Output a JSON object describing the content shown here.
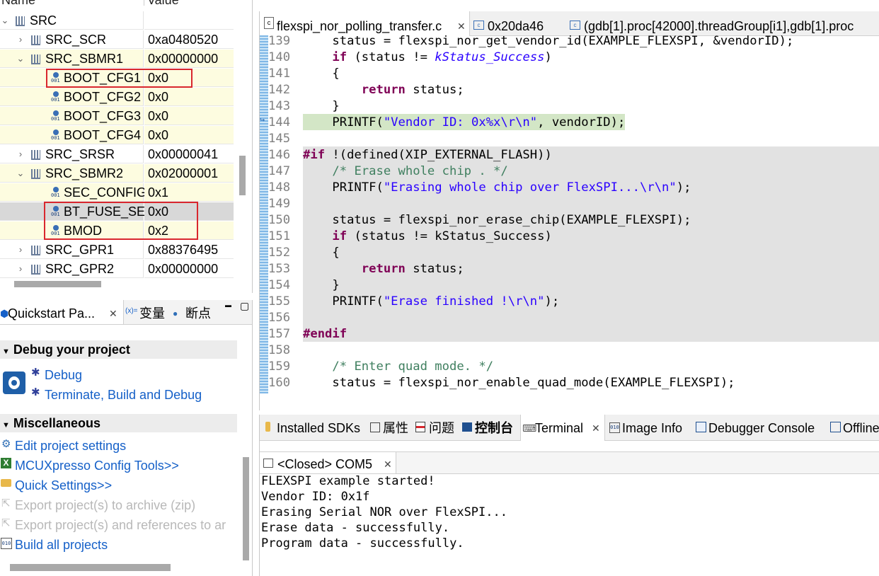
{
  "registers": {
    "header": {
      "name": "Name",
      "value": "Value"
    },
    "rows": [
      {
        "label": "SRC",
        "value": "",
        "level": 0,
        "twisty": "open",
        "kind": "group"
      },
      {
        "label": "SRC_SCR",
        "value": "0xa0480520",
        "level": 1,
        "twisty": "closed",
        "kind": "register"
      },
      {
        "label": "SRC_SBMR1",
        "value": "0x00000000",
        "level": 1,
        "twisty": "open",
        "kind": "register"
      },
      {
        "label": "BOOT_CFG1",
        "value": "0x0",
        "level": 2,
        "kind": "field"
      },
      {
        "label": "BOOT_CFG2",
        "value": "0x0",
        "level": 2,
        "kind": "field"
      },
      {
        "label": "BOOT_CFG3",
        "value": "0x0",
        "level": 2,
        "kind": "field"
      },
      {
        "label": "BOOT_CFG4",
        "value": "0x0",
        "level": 2,
        "kind": "field"
      },
      {
        "label": "SRC_SRSR",
        "value": "0x00000041",
        "level": 1,
        "twisty": "closed",
        "kind": "register"
      },
      {
        "label": "SRC_SBMR2",
        "value": "0x02000001",
        "level": 1,
        "twisty": "open",
        "kind": "register"
      },
      {
        "label": "SEC_CONFIG",
        "value": "0x1",
        "level": 2,
        "kind": "field"
      },
      {
        "label": "BT_FUSE_SEL",
        "value": "0x0",
        "level": 2,
        "kind": "field"
      },
      {
        "label": "BMOD",
        "value": "0x2",
        "level": 2,
        "kind": "field"
      },
      {
        "label": "SRC_GPR1",
        "value": "0x88376495",
        "level": 1,
        "twisty": "closed",
        "kind": "register"
      },
      {
        "label": "SRC_GPR2",
        "value": "0x00000000",
        "level": 1,
        "twisty": "closed",
        "kind": "register"
      }
    ],
    "field_icon_bits": "001"
  },
  "quickstart": {
    "tabs": [
      {
        "label": "Quickstart Pa...",
        "close": "✕"
      },
      {
        "label": "变量",
        "prefix": "(x)="
      },
      {
        "label": "断点"
      }
    ],
    "window_buttons": {
      "minimize": "▬",
      "maximize": "▢"
    },
    "sections": [
      {
        "title": "Debug your project",
        "items": [
          {
            "label": "Debug",
            "icon": "bug-icon",
            "disabled": false
          },
          {
            "label": "Terminate, Build and Debug",
            "icon": "bug-icon",
            "disabled": false
          }
        ]
      },
      {
        "title": "Miscellaneous",
        "items": [
          {
            "label": "Edit project settings",
            "icon": "settings-icon",
            "disabled": false
          },
          {
            "label": "MCUXpresso Config Tools>>",
            "icon": "config-tools-icon",
            "disabled": false
          },
          {
            "label": "Quick Settings>>",
            "icon": "folder-icon",
            "disabled": false
          },
          {
            "label": "Export project(s) to archive (zip)",
            "icon": "export-icon",
            "disabled": true
          },
          {
            "label": "Export project(s) and references to ar",
            "icon": "export-icon",
            "disabled": true
          },
          {
            "label": "Build all projects",
            "icon": "build-icon",
            "disabled": false
          }
        ]
      }
    ]
  },
  "editor": {
    "tabs": [
      {
        "label": "flexspi_nor_polling_transfer.c",
        "close": "✕",
        "active": true
      },
      {
        "label": "0x20da46",
        "active": false
      },
      {
        "label": "(gdb[1].proc[42000].threadGroup[i1],gdb[1].proc",
        "active": false
      }
    ],
    "lines": [
      {
        "num": "139",
        "parts": [
          {
            "t": "    status = flexspi_nor_get_vendor_id(EXAMPLE_FLEXSPI, &vendorID);",
            "c": ""
          }
        ]
      },
      {
        "num": "140",
        "parts": [
          {
            "t": "    ",
            "c": ""
          },
          {
            "t": "if",
            "c": "kw"
          },
          {
            "t": " (status != ",
            "c": ""
          },
          {
            "t": "kStatus_Success",
            "c": "it"
          },
          {
            "t": ")",
            "c": ""
          }
        ]
      },
      {
        "num": "141",
        "parts": [
          {
            "t": "    {",
            "c": ""
          }
        ]
      },
      {
        "num": "142",
        "parts": [
          {
            "t": "        ",
            "c": ""
          },
          {
            "t": "return",
            "c": "kw"
          },
          {
            "t": " status;",
            "c": ""
          }
        ]
      },
      {
        "num": "143",
        "parts": [
          {
            "t": "    }",
            "c": ""
          }
        ]
      },
      {
        "num": "144",
        "highlight": true,
        "parts": [
          {
            "t": "    PRINTF(",
            "c": ""
          },
          {
            "t": "\"Vendor ID: 0x%x\\r\\n\"",
            "c": "str"
          },
          {
            "t": ", vendorID);",
            "c": ""
          }
        ]
      },
      {
        "num": "145",
        "parts": [
          {
            "t": "",
            "c": ""
          }
        ]
      },
      {
        "num": "146",
        "inactive": true,
        "parts": [
          {
            "t": "#if",
            "c": "kw"
          },
          {
            "t": " !(defined(XIP_EXTERNAL_FLASH))",
            "c": ""
          }
        ]
      },
      {
        "num": "147",
        "inactive": true,
        "parts": [
          {
            "t": "    ",
            "c": ""
          },
          {
            "t": "/* Erase whole chip . */",
            "c": "cmt"
          }
        ]
      },
      {
        "num": "148",
        "inactive": true,
        "parts": [
          {
            "t": "    PRINTF(",
            "c": ""
          },
          {
            "t": "\"Erasing whole chip over FlexSPI...\\r\\n\"",
            "c": "str"
          },
          {
            "t": ");",
            "c": ""
          }
        ]
      },
      {
        "num": "149",
        "inactive": true,
        "parts": [
          {
            "t": "",
            "c": ""
          }
        ]
      },
      {
        "num": "150",
        "inactive": true,
        "parts": [
          {
            "t": "    status = flexspi_nor_erase_chip(EXAMPLE_FLEXSPI);",
            "c": ""
          }
        ]
      },
      {
        "num": "151",
        "inactive": true,
        "parts": [
          {
            "t": "    ",
            "c": ""
          },
          {
            "t": "if",
            "c": "kw"
          },
          {
            "t": " (status != kStatus_Success)",
            "c": ""
          }
        ]
      },
      {
        "num": "152",
        "inactive": true,
        "parts": [
          {
            "t": "    {",
            "c": ""
          }
        ]
      },
      {
        "num": "153",
        "inactive": true,
        "parts": [
          {
            "t": "        ",
            "c": ""
          },
          {
            "t": "return",
            "c": "kw"
          },
          {
            "t": " status;",
            "c": ""
          }
        ]
      },
      {
        "num": "154",
        "inactive": true,
        "parts": [
          {
            "t": "    }",
            "c": ""
          }
        ]
      },
      {
        "num": "155",
        "inactive": true,
        "parts": [
          {
            "t": "    PRINTF(",
            "c": ""
          },
          {
            "t": "\"Erase finished !\\r\\n\"",
            "c": "str"
          },
          {
            "t": ");",
            "c": ""
          }
        ]
      },
      {
        "num": "156",
        "inactive": true,
        "parts": [
          {
            "t": "",
            "c": ""
          }
        ]
      },
      {
        "num": "157",
        "inactive": true,
        "parts": [
          {
            "t": "#endif",
            "c": "kw"
          }
        ]
      },
      {
        "num": "158",
        "parts": [
          {
            "t": "",
            "c": ""
          }
        ]
      },
      {
        "num": "159",
        "parts": [
          {
            "t": "    ",
            "c": ""
          },
          {
            "t": "/* Enter quad mode. */",
            "c": "cmt"
          }
        ]
      },
      {
        "num": "160",
        "parts": [
          {
            "t": "    status = flexspi_nor_enable_quad_mode(EXAMPLE_FLEXSPI);",
            "c": ""
          }
        ]
      }
    ]
  },
  "bottom_views": {
    "tabs": [
      {
        "label": "Installed SDKs",
        "icon": "sdk-icon"
      },
      {
        "label": "属性",
        "icon": "properties-icon"
      },
      {
        "label": "问题",
        "icon": "problems-icon"
      },
      {
        "label": "控制台",
        "icon": "console-icon"
      },
      {
        "label": "Terminal",
        "icon": "terminal-icon",
        "close": "✕",
        "active": true
      },
      {
        "label": "Image Info",
        "icon": "image-info-icon"
      },
      {
        "label": "Debugger Console",
        "icon": "debugger-console-icon"
      },
      {
        "label": "Offline",
        "icon": "offline-icon"
      }
    ],
    "console_tab": {
      "label": "<Closed> COM5",
      "close": "✕"
    },
    "console_lines": [
      "FLEXSPI example started!",
      "Vendor ID: 0x1f",
      "Erasing Serial NOR over FlexSPI...",
      "Erase data - successfully.",
      "Program data - successfully."
    ]
  },
  "colors": {
    "highlight_box": "#d9272e",
    "link": "#1560c8",
    "keyword": "#7f0055",
    "string": "#2a00ff",
    "comment": "#3f7f5f"
  }
}
